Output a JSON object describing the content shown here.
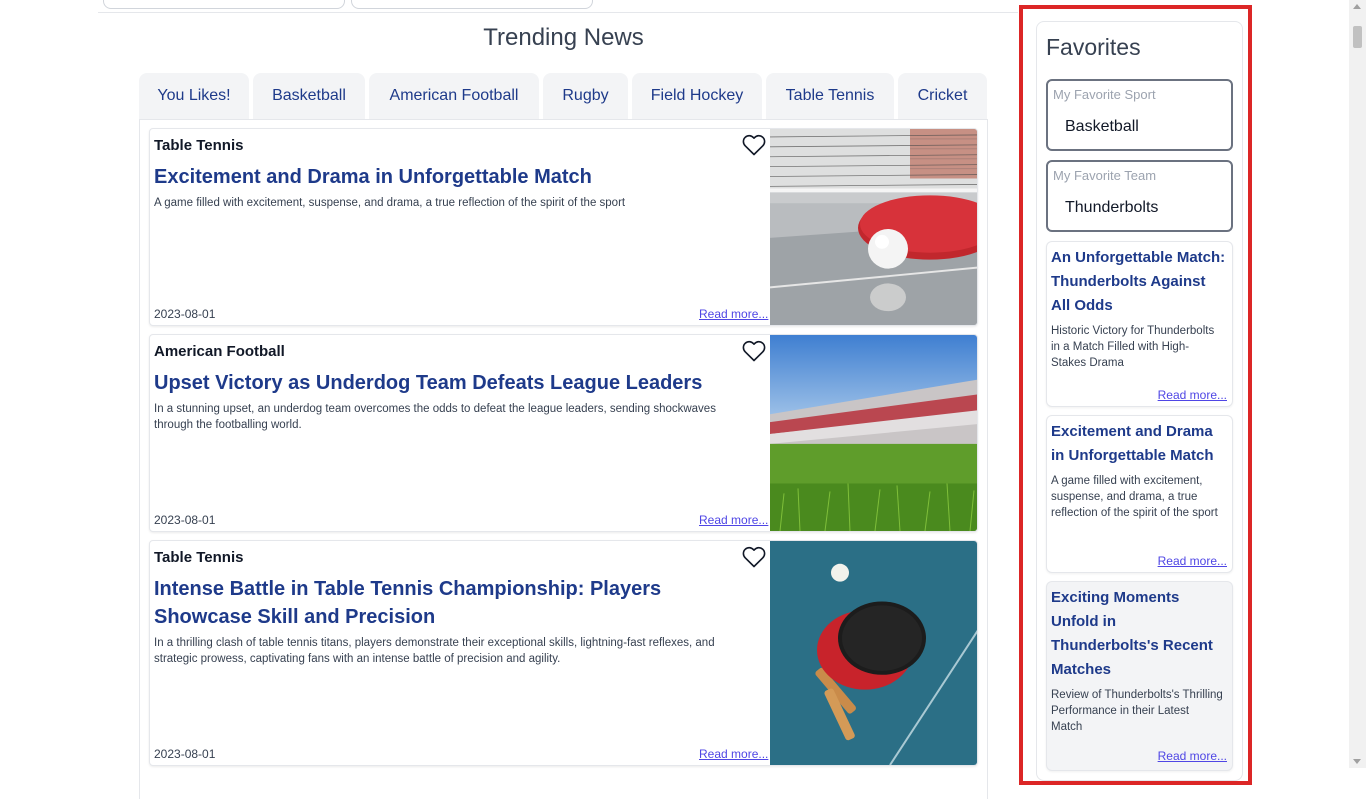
{
  "trending": {
    "title": "Trending News",
    "tabs": [
      "You Likes!",
      "Basketball",
      "American Football",
      "Rugby",
      "Field Hockey",
      "Table Tennis",
      "Cricket"
    ],
    "articles": [
      {
        "sport": "Table Tennis",
        "headline": "Excitement and Drama in Unforgettable Match",
        "summary": "A game filled with excitement, suspense, and drama, a true reflection of the spirit of the sport",
        "date": "2023-08-01",
        "read_more": "Read more...",
        "heart_icon": "heart-outline-icon"
      },
      {
        "sport": "American Football",
        "headline": "Upset Victory as Underdog Team Defeats League Leaders",
        "summary": "In a stunning upset, an underdog team overcomes the odds to defeat the league leaders, sending shockwaves through the footballing world.",
        "date": "2023-08-01",
        "read_more": "Read more...",
        "heart_icon": "heart-outline-icon"
      },
      {
        "sport": "Table Tennis",
        "headline": "Intense Battle in Table Tennis Championship: Players Showcase Skill and Precision",
        "summary": "In a thrilling clash of table tennis titans, players demonstrate their exceptional skills, lightning-fast reflexes, and strategic prowess, captivating fans with an intense battle of precision and agility.",
        "date": "2023-08-01",
        "read_more": "Read more...",
        "heart_icon": "heart-outline-icon"
      }
    ]
  },
  "favorites": {
    "title": "Favorites",
    "sport_label": "My Favorite Sport",
    "sport_value": "Basketball",
    "team_label": "My Favorite Team",
    "team_value": "Thunderbolts",
    "items": [
      {
        "title": "An Unforgettable Match: Thunderbolts Against All Odds",
        "summary": "Historic Victory for Thunderbolts in a Match Filled with High-Stakes Drama",
        "read_more": "Read more..."
      },
      {
        "title": "Excitement and Drama in Unforgettable Match",
        "summary": "A game filled with excitement, suspense, and drama, a true reflection of the spirit of the sport",
        "read_more": "Read more..."
      },
      {
        "title": "Exciting Moments Unfold in Thunderbolts's Recent Matches",
        "summary": "Review of Thunderbolts's Thrilling Performance in their Latest Match",
        "read_more": "Read more..."
      }
    ]
  },
  "colors": {
    "accent_navy": "#1e3a8a",
    "link": "#4f46e5",
    "highlight_outline": "#dc2626"
  }
}
